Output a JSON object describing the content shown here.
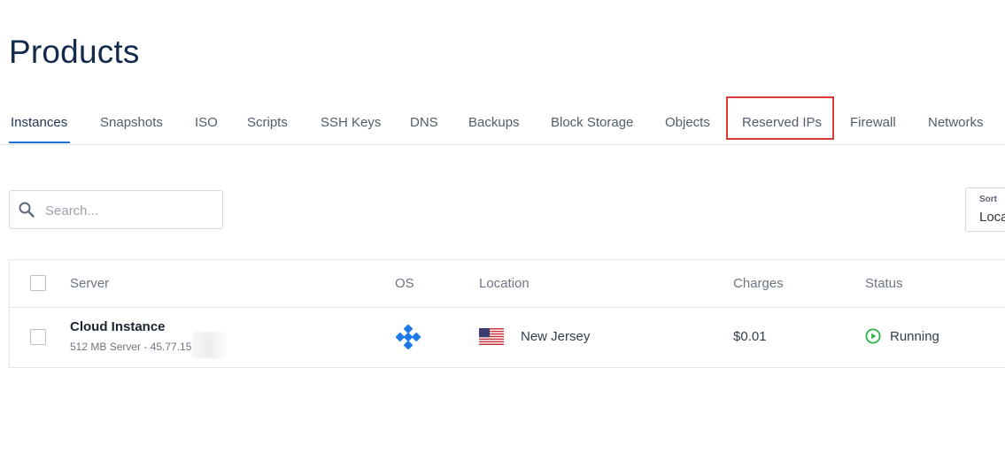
{
  "page": {
    "title": "Products"
  },
  "tabs": [
    {
      "label": "Instances",
      "active": true
    },
    {
      "label": "Snapshots"
    },
    {
      "label": "ISO"
    },
    {
      "label": "Scripts"
    },
    {
      "label": "SSH Keys"
    },
    {
      "label": "DNS"
    },
    {
      "label": "Backups"
    },
    {
      "label": "Block Storage"
    },
    {
      "label": "Objects"
    },
    {
      "label": "Reserved IPs",
      "highlighted": true
    },
    {
      "label": "Firewall"
    },
    {
      "label": "Networks"
    }
  ],
  "search": {
    "placeholder": "Search...",
    "icon": "search-icon"
  },
  "sort": {
    "label": "Sort",
    "value": "Loca"
  },
  "table": {
    "columns": [
      "Server",
      "OS",
      "Location",
      "Charges",
      "Status"
    ],
    "rows": [
      {
        "server_name": "Cloud Instance",
        "server_sub": "512 MB Server - 45.77.15",
        "os_icon": "os-logo-icon",
        "location": "New Jersey",
        "flag_icon": "us-flag-icon",
        "charges": "$0.01",
        "status": "Running",
        "status_icon": "running-icon"
      }
    ]
  },
  "colors": {
    "accent": "#1b6fd8",
    "highlight": "#d93a33",
    "status_running": "#2bb24c",
    "title": "#142a4c"
  }
}
